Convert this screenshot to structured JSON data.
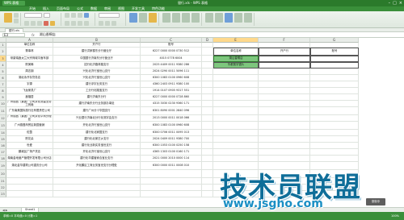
{
  "app": {
    "logo": "WPS 表格",
    "window_title": "银行.xls - WPS 表格"
  },
  "menu": [
    "开始",
    "插入",
    "页面布局",
    "公式",
    "数据",
    "审阅",
    "视图",
    "开发工具",
    "特色功能"
  ],
  "doc_tab": "银行.xls",
  "formula_bar": {
    "name_box": "E3",
    "fx": "fx",
    "value": "湖山香桐店"
  },
  "columns": [
    "A",
    "B",
    "C",
    "D",
    "E",
    "F",
    "G"
  ],
  "rows": [
    "1",
    "2",
    "3",
    "4",
    "5",
    "6",
    "7",
    "8",
    "9",
    "10",
    "11",
    "12",
    "13",
    "14",
    "15",
    "16",
    "17",
    "18",
    "19",
    "20",
    "21",
    "22",
    "23"
  ],
  "headers": {
    "a": "单位名称",
    "b": "开户行",
    "c": "账号"
  },
  "table": [
    [
      "董事林",
      "建行洪家楼东分行营业厅",
      "6227 0000 0000 0730 512"
    ],
    [
      "帝豪瑞鑫太兰大宗商城平面车部",
      "中国银行济南东分行营业厅",
      "4015 0778 6004"
    ],
    [
      "陈美琳",
      "招行化济路林路支行",
      "2025 4409 0011 9380 286"
    ],
    [
      "周志钢",
      "兴化北济行宝世山支行",
      "2024 0290 0011 5096 111"
    ],
    [
      "湖北永开存货务店",
      "兴化北济行宝世山支行",
      "6300 1083 0100 0960 608"
    ],
    [
      "宇源",
      "建行浮宇业务支行",
      "4360 2403 0911 9380 100"
    ],
    [
      "飞龙家具厂",
      "工分行化路宝支行",
      "1914 0107 0905 9317 551"
    ],
    [
      "鑫福居",
      "建行济南东分行",
      "6227 0000 0000 0728 860"
    ],
    [
      "广州德昌（集团）公司京化测量业务工商局",
      "建行济南东分行业务部办事处",
      "4315 3030 0230 9360 171"
    ],
    [
      "广东南美国际旅行社有限责任公司",
      "建行广州分十华园支行",
      "6301 8090 0001 2840 096"
    ],
    [
      "广州德昌（集团）公司京化华商分理处",
      "兴业银行济南北分行化测字会支行",
      "2013 0000 0011 0018 066"
    ],
    [
      "广州德昌商贸区新园营销",
      "开化北济行宝世山支行",
      "6300 1083 0100 0960 608"
    ],
    [
      "佐茵",
      "建行化北家园支行",
      "6300 0706 0011 0095 013"
    ],
    [
      "陈花朵",
      "建行化北家庄乡支行",
      "2024 0409 0011 9380 700"
    ],
    [
      "世爱",
      "建行化业新实务宝世支行",
      "6300 1053 0100 0250 158"
    ],
    [
      "鹏城区广场产货店",
      "开化北济行宝世山支行",
      "4365 1303 0100 0160 171"
    ],
    [
      "湖南金地营产管理开发有限公司分店",
      "建行化华建管家合宝业支行",
      "2021 0000 2010 0000 114"
    ],
    [
      "湖北金华建筑公司重庆分公司",
      "开化鹏区工商业务宝世支行分理处",
      "6300 0000 0011 0008 010"
    ]
  ],
  "lookup": {
    "headers": [
      "单位名称",
      "开户行",
      "账号"
    ],
    "rows": [
      [
        "湖山香桐店",
        "",
        ""
      ],
      [
        "华都宽宇银片",
        "",
        ""
      ]
    ]
  },
  "sheet_tab": "Sheet1",
  "status": "求和=0  平均值=0  计数=1",
  "zoom": "100%",
  "watermark": {
    "title": "技术员联盟",
    "url": "www.jsgho.com"
  },
  "rec_badge": "录制中"
}
